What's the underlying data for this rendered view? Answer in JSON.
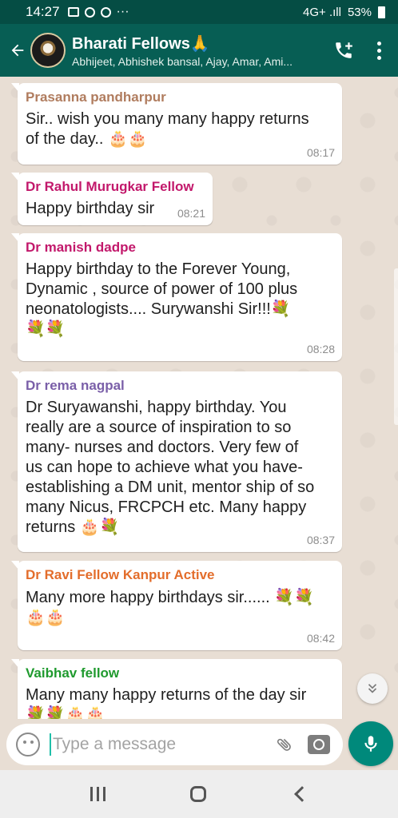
{
  "status_bar": {
    "time": "14:27",
    "dots": "···",
    "network": "4G+ .ıll",
    "battery": "53%"
  },
  "header": {
    "title": "Bharati Fellows🙏",
    "subtitle": "Abhijeet, Abhishek bansal, Ajay, Amar, Ami..."
  },
  "messages": [
    {
      "sender": "Prasanna pandharpur",
      "sender_color": "#b07c5e",
      "lines": [
        "Sir.. wish you many many happy returns",
        "of the day.. 🎂🎂"
      ],
      "time": "08:17"
    },
    {
      "sender": "Dr Rahul Murugkar Fellow",
      "sender_color": "#c2186b",
      "lines": [
        "Happy birthday sir"
      ],
      "time": "08:21"
    },
    {
      "sender": "Dr manish dadpe",
      "sender_color": "#c2186b",
      "lines": [
        "Happy birthday to the Forever Young,",
        "Dynamic , source of power of 100 plus",
        "neonatologists....     Surywanshi Sir!!!💐",
        "💐💐"
      ],
      "time": "08:28"
    },
    {
      "sender": "Dr rema nagpal",
      "sender_color": "#7a5fa8",
      "lines": [
        "Dr Suryawanshi, happy birthday. You",
        "really are a source of inspiration to so",
        "many- nurses and doctors. Very few of",
        "us can hope to achieve what you have-",
        "establishing a DM unit, mentor ship of so",
        "many Nicus, FRCPCH etc. Many happy",
        "returns 🎂💐"
      ],
      "time": "08:37"
    },
    {
      "sender": "Dr Ravi Fellow Kanpur Active",
      "sender_color": "#e36d2b",
      "lines": [
        "Many more happy birthdays sir...... 💐💐",
        "🎂🎂"
      ],
      "time": "08:42"
    },
    {
      "sender": "Vaibhav fellow",
      "sender_color": "#1f9a2e",
      "lines": [
        "Many many happy returns of the day sir",
        "💐💐🎂🎂"
      ],
      "time": ""
    }
  ],
  "input": {
    "placeholder": "Type a message"
  },
  "icons": {
    "back": "arrow-back",
    "add_call": "add-call",
    "menu": "more-vert",
    "emoji": "emoji-smile",
    "attach": "paperclip",
    "camera": "camera",
    "mic": "microphone",
    "scroll_down": "double-chevron-down"
  },
  "colors": {
    "header": "#075e54",
    "status_bar": "#054d44",
    "accent": "#00897b",
    "bubble": "#ffffff"
  }
}
